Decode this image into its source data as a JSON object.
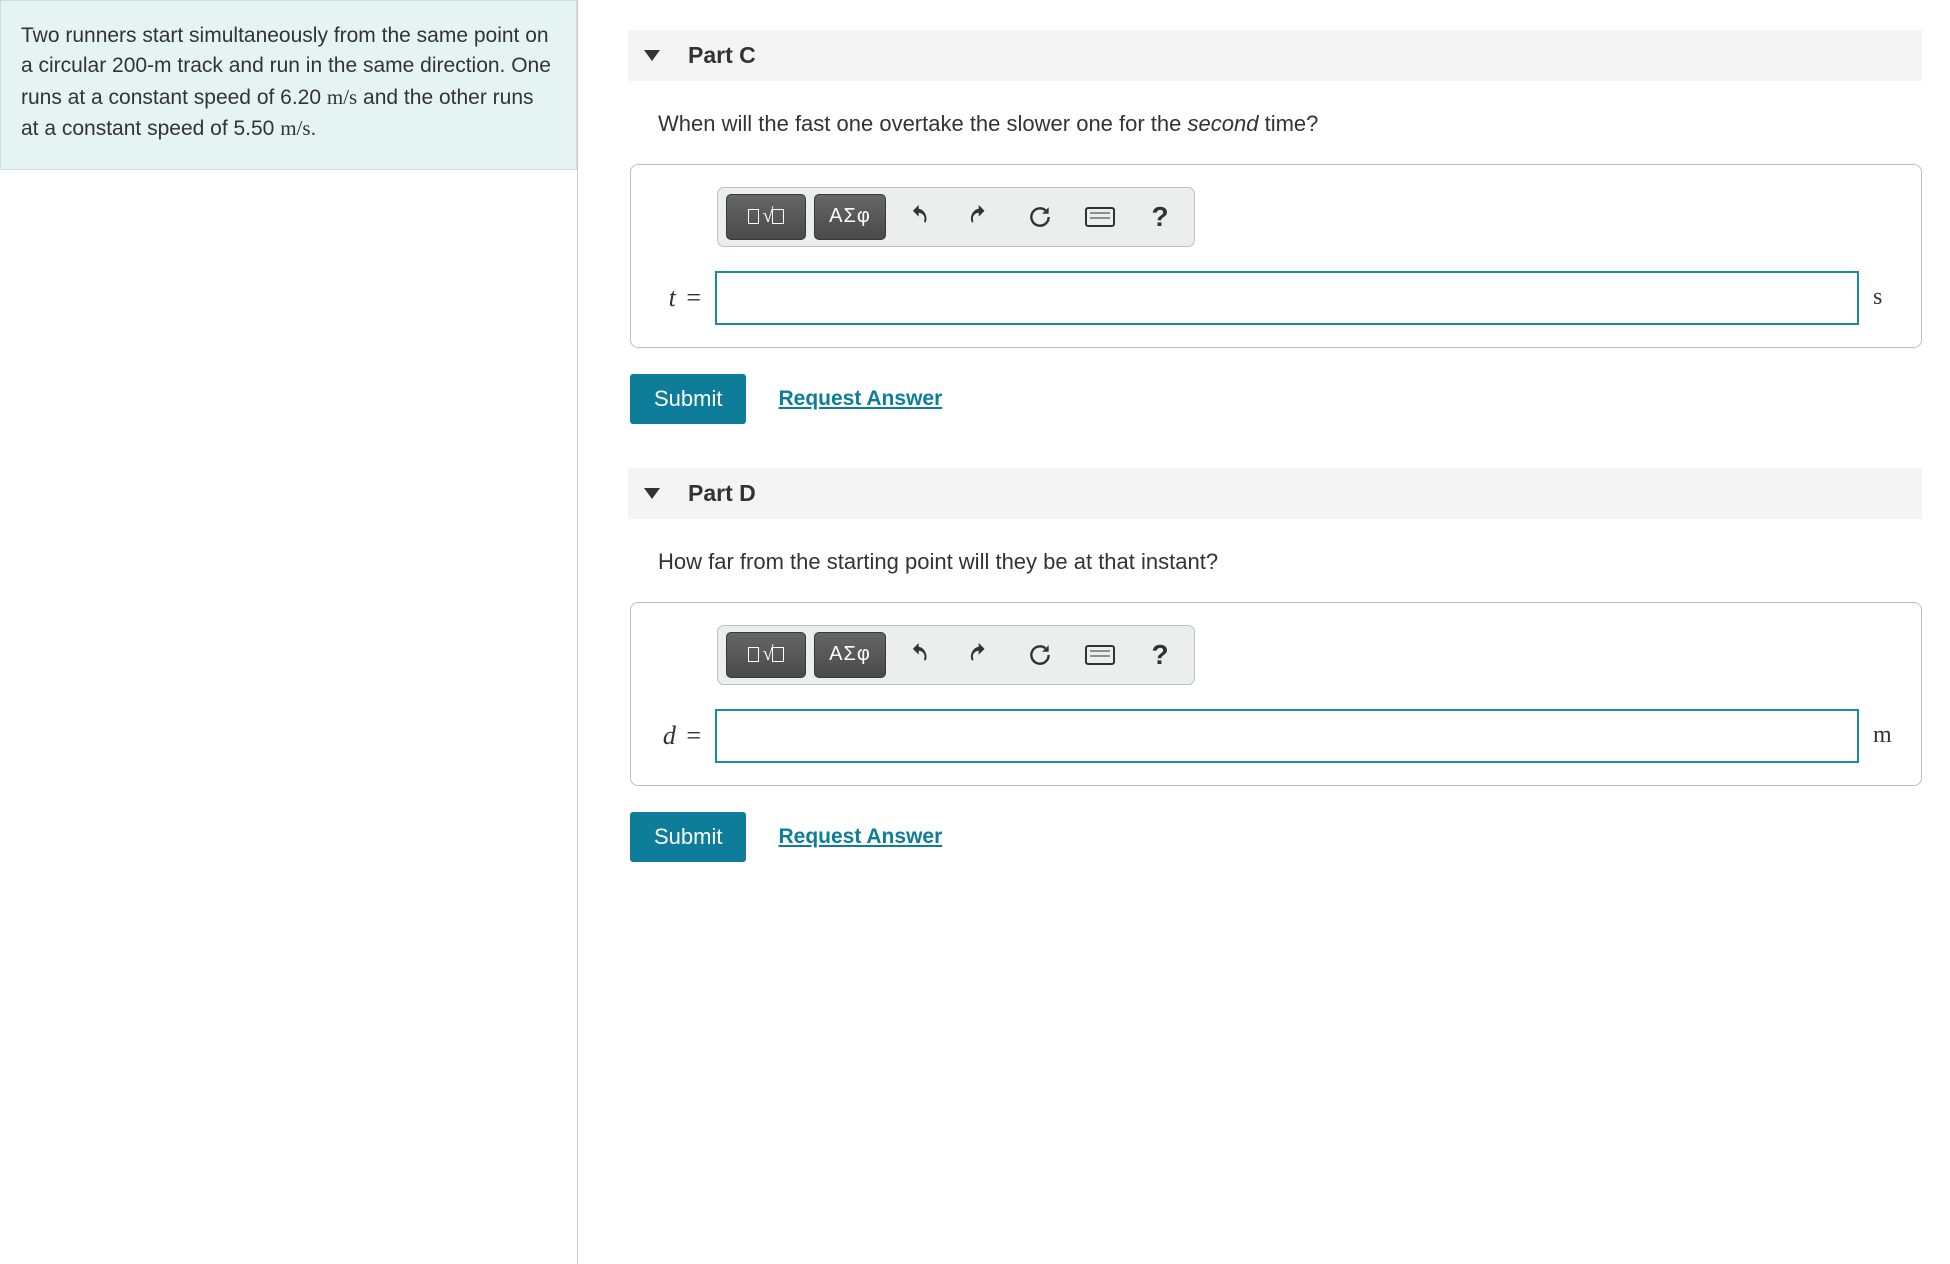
{
  "problem": {
    "text_part1": "Two runners start simultaneously from the same point on a circular 200-m track and run in the same direction. One runs at a constant speed of 6.20 ",
    "unit1": "m/s",
    "text_part2": " and the other runs at a constant speed of 5.50 ",
    "unit2": "m/s",
    "text_part3": "."
  },
  "parts": [
    {
      "label": "Part C",
      "question_pre": "When will the fast one overtake the slower one for the ",
      "question_em": "second",
      "question_post": " time?",
      "variable": "t",
      "unit": "s",
      "value": "",
      "toolbar": {
        "greek": "ΑΣφ",
        "help": "?"
      },
      "submit": "Submit",
      "request": "Request Answer"
    },
    {
      "label": "Part D",
      "question_pre": "How far from the starting point will they be at that instant?",
      "question_em": "",
      "question_post": "",
      "variable": "d",
      "unit": "m",
      "value": "",
      "toolbar": {
        "greek": "ΑΣφ",
        "help": "?"
      },
      "submit": "Submit",
      "request": "Request Answer"
    }
  ]
}
